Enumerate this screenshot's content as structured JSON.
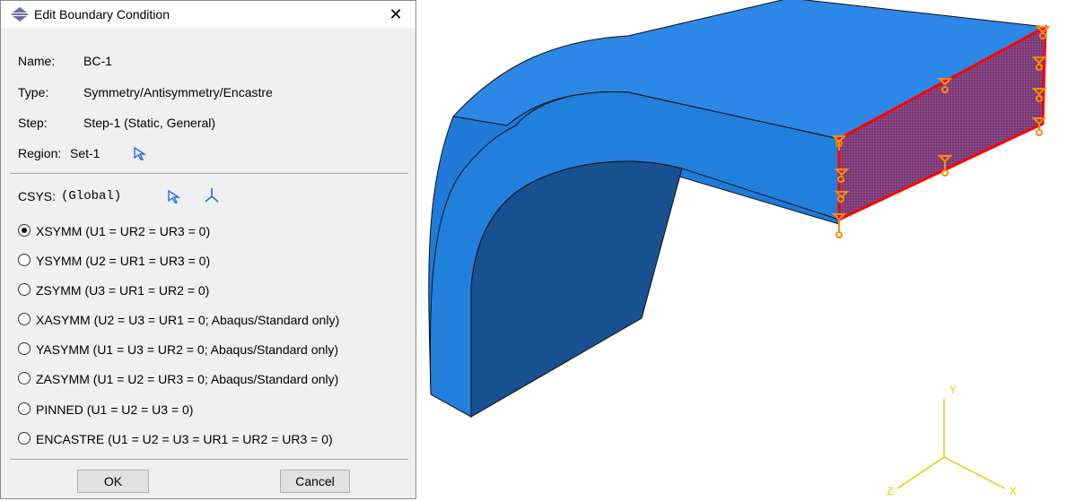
{
  "dialog": {
    "title": "Edit Boundary Condition",
    "close_glyph": "✕",
    "name_label": "Name:",
    "name_value": "BC-1",
    "type_label": "Type:",
    "type_value": "Symmetry/Antisymmetry/Encastre",
    "step_label": "Step:",
    "step_value": "Step-1 (Static, General)",
    "region_label": "Region:",
    "region_value": "Set-1",
    "csys_label": "CSYS:",
    "csys_value": "(Global)",
    "options": [
      {
        "label": "XSYMM (U1 = UR2 = UR3 = 0)",
        "selected": true
      },
      {
        "label": "YSYMM (U2 = UR1 = UR3 = 0)",
        "selected": false
      },
      {
        "label": "ZSYMM (U3 = UR1 = UR2 = 0)",
        "selected": false
      },
      {
        "label": "XASYMM (U2 = U3 = UR1 = 0; Abaqus/Standard only)",
        "selected": false
      },
      {
        "label": "YASYMM (U1 = U3 = UR2 = 0; Abaqus/Standard only)",
        "selected": false
      },
      {
        "label": "ZASYMM (U1 = U2 = UR3 = 0; Abaqus/Standard only)",
        "selected": false
      },
      {
        "label": "PINNED (U1 = U2 = U3 = 0)",
        "selected": false
      },
      {
        "label": "ENCASTRE (U1 = U2 = U3 = UR1 = UR2 = UR3 = 0)",
        "selected": false
      }
    ],
    "ok_label": "OK",
    "cancel_label": "Cancel"
  },
  "triad": {
    "x_label": "X",
    "y_label": "Y",
    "z_label": "Z"
  },
  "colors": {
    "part_face_top": "#2382e0",
    "part_face_dark": "#1a5fa8",
    "selected_face": "#8a3a6e",
    "selected_edge": "#ff0000",
    "bc_symbol": "#ff8c00",
    "triad": "#d4d400",
    "select_arrow": "#1e6fe0"
  }
}
